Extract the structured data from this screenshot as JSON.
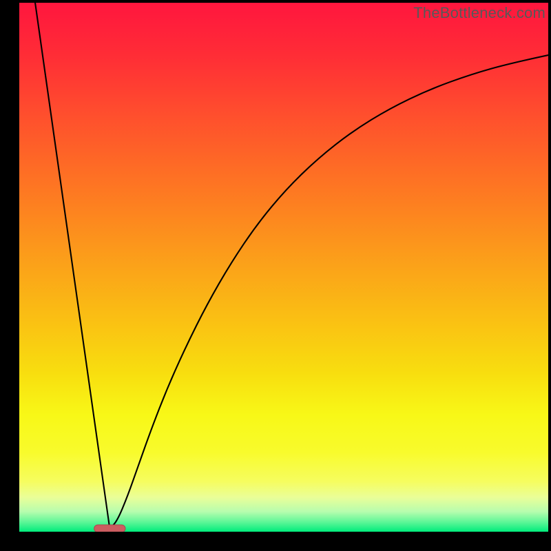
{
  "watermark": {
    "text": "TheBottleneck.com"
  },
  "gradient": {
    "stops": [
      {
        "offset": 0.0,
        "color": "#ff163e"
      },
      {
        "offset": 0.1,
        "color": "#ff2d36"
      },
      {
        "offset": 0.2,
        "color": "#ff4b2e"
      },
      {
        "offset": 0.3,
        "color": "#fe6826"
      },
      {
        "offset": 0.4,
        "color": "#fd851f"
      },
      {
        "offset": 0.5,
        "color": "#fba319"
      },
      {
        "offset": 0.6,
        "color": "#fac013"
      },
      {
        "offset": 0.7,
        "color": "#f8de0f"
      },
      {
        "offset": 0.78,
        "color": "#f8f817"
      },
      {
        "offset": 0.85,
        "color": "#f8fb2c"
      },
      {
        "offset": 0.905,
        "color": "#f6fd5f"
      },
      {
        "offset": 0.935,
        "color": "#eafe98"
      },
      {
        "offset": 0.962,
        "color": "#b7fdae"
      },
      {
        "offset": 0.982,
        "color": "#5cf697"
      },
      {
        "offset": 1.0,
        "color": "#00ec7c"
      }
    ]
  },
  "marker": {
    "x_frac": 0.171,
    "y_frac": 0.994,
    "width_frac": 0.059,
    "height_frac": 0.014,
    "fill": "#cb5d60",
    "stroke": "#a84a4e"
  },
  "curve": {
    "stroke": "#000000",
    "stroke_width": 2.1,
    "left_x_start_frac": 0.03,
    "left_y_start_frac": 0.0,
    "vertex_x_frac": 0.171,
    "vertex_y_frac": 0.994,
    "right_points": [
      {
        "x_frac": 0.185,
        "y_frac": 0.98
      },
      {
        "x_frac": 0.205,
        "y_frac": 0.932
      },
      {
        "x_frac": 0.225,
        "y_frac": 0.875
      },
      {
        "x_frac": 0.25,
        "y_frac": 0.805
      },
      {
        "x_frac": 0.28,
        "y_frac": 0.728
      },
      {
        "x_frac": 0.315,
        "y_frac": 0.65
      },
      {
        "x_frac": 0.355,
        "y_frac": 0.57
      },
      {
        "x_frac": 0.4,
        "y_frac": 0.492
      },
      {
        "x_frac": 0.45,
        "y_frac": 0.418
      },
      {
        "x_frac": 0.505,
        "y_frac": 0.352
      },
      {
        "x_frac": 0.565,
        "y_frac": 0.294
      },
      {
        "x_frac": 0.63,
        "y_frac": 0.243
      },
      {
        "x_frac": 0.7,
        "y_frac": 0.2
      },
      {
        "x_frac": 0.775,
        "y_frac": 0.164
      },
      {
        "x_frac": 0.855,
        "y_frac": 0.135
      },
      {
        "x_frac": 0.93,
        "y_frac": 0.114
      },
      {
        "x_frac": 1.0,
        "y_frac": 0.099
      }
    ]
  },
  "chart_data": {
    "type": "line",
    "title": "",
    "xlabel": "",
    "ylabel": "",
    "xlim": [
      0,
      1
    ],
    "ylim": [
      0,
      1
    ],
    "series": [
      {
        "name": "bottleneck-curve",
        "x": [
          0.03,
          0.06,
          0.09,
          0.12,
          0.15,
          0.171,
          0.185,
          0.205,
          0.225,
          0.25,
          0.28,
          0.315,
          0.355,
          0.4,
          0.45,
          0.505,
          0.565,
          0.63,
          0.7,
          0.775,
          0.855,
          0.93,
          1.0
        ],
        "y": [
          1.0,
          0.79,
          0.58,
          0.37,
          0.15,
          0.006,
          0.02,
          0.068,
          0.125,
          0.195,
          0.272,
          0.35,
          0.43,
          0.508,
          0.582,
          0.648,
          0.706,
          0.757,
          0.8,
          0.836,
          0.865,
          0.886,
          0.901
        ]
      }
    ],
    "annotations": [
      {
        "type": "marker",
        "shape": "rounded-rect",
        "x": 0.171,
        "y": 0.006,
        "label": "optimal-point"
      }
    ],
    "background": "vertical-gradient red→orange→yellow→green"
  }
}
